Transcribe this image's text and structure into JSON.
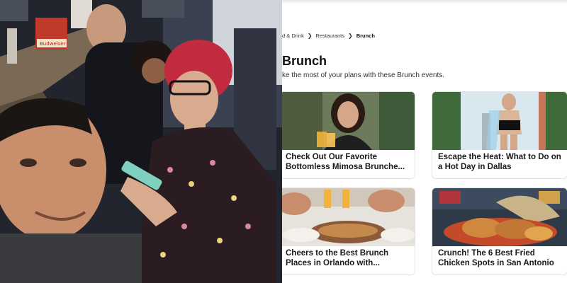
{
  "breadcrumb": {
    "items": [
      "d & Drink",
      "Restaurants",
      "Brunch"
    ]
  },
  "page": {
    "title": "Brunch",
    "subtitle": "ke the most of your plans with these Brunch events."
  },
  "cards": [
    {
      "title": "Check Out Our Favorite Bottomless Mimosa Brunche..."
    },
    {
      "title": "Escape the Heat: What to Do on a Hot Day in Dallas"
    },
    {
      "title": "Cheers to the Best Brunch Places in Orlando with..."
    },
    {
      "title": "Crunch! The 6 Best Fried Chicken Spots in San Antonio"
    }
  ],
  "photo": {
    "sign_text": "Budweiser"
  }
}
